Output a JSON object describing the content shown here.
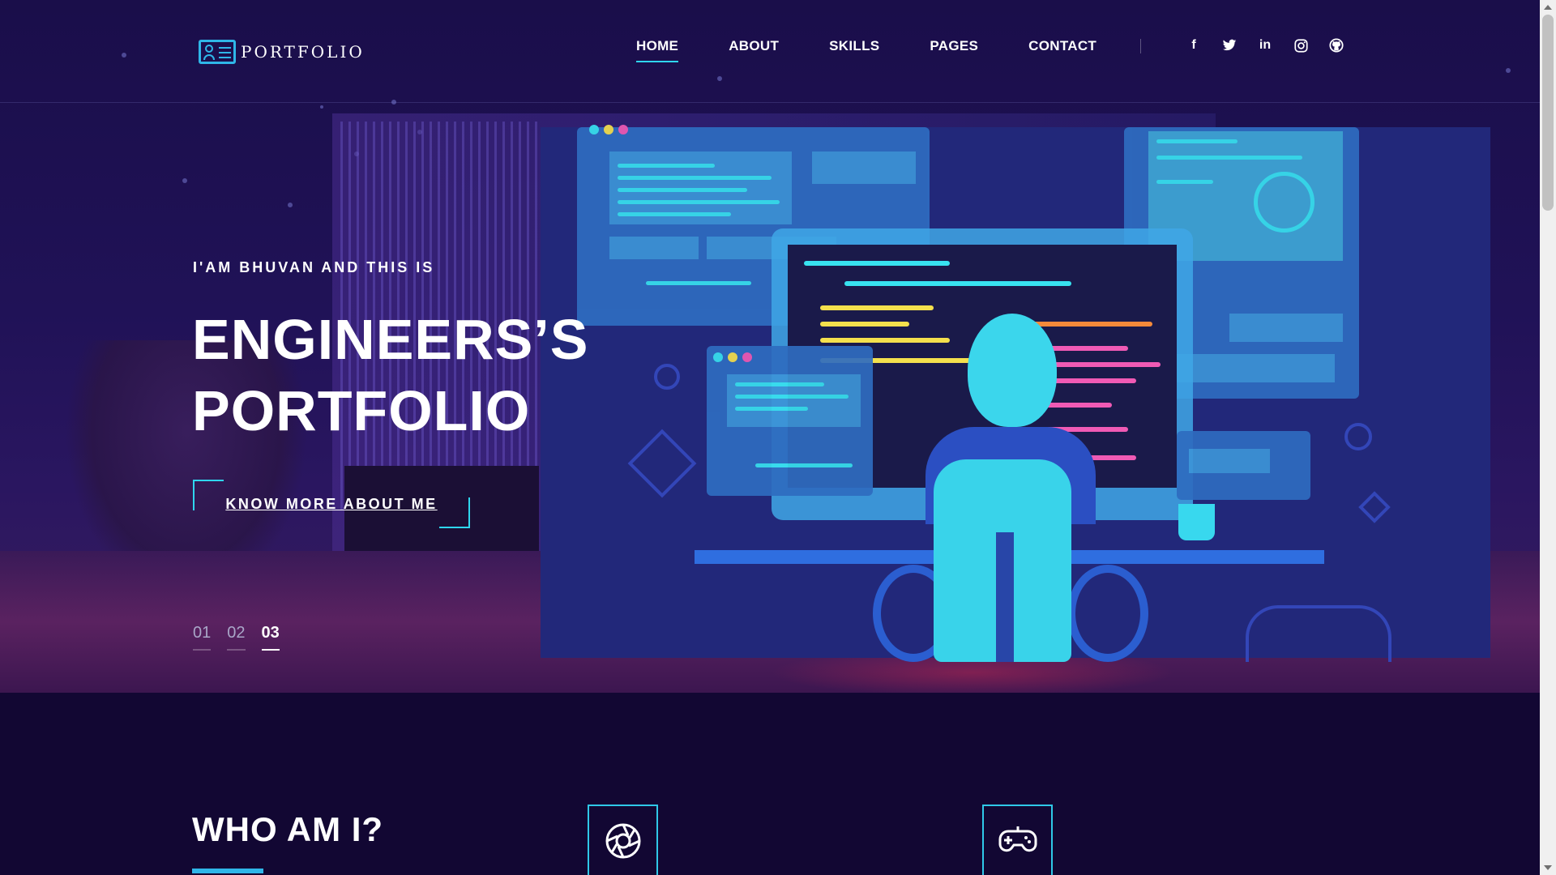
{
  "brand": {
    "logo_text": "PORTFOLIO"
  },
  "nav": {
    "items": [
      {
        "label": "HOME",
        "active": true
      },
      {
        "label": "ABOUT",
        "active": false
      },
      {
        "label": "SKILLS",
        "active": false
      },
      {
        "label": "PAGES",
        "active": false
      },
      {
        "label": "CONTACT",
        "active": false
      }
    ],
    "social": [
      {
        "icon": "facebook-icon",
        "glyph": "f"
      },
      {
        "icon": "twitter-icon",
        "glyph": "🐦"
      },
      {
        "icon": "linkedin-icon",
        "glyph": "in"
      },
      {
        "icon": "instagram-icon",
        "glyph": "◎"
      },
      {
        "icon": "github-icon",
        "glyph": "●"
      }
    ]
  },
  "hero": {
    "kicker": "I'AM BHUVAN AND THIS IS",
    "title_line1": "ENGINEERS’S",
    "title_line2": "PORTFOLIO",
    "cta_label": "KNOW MORE ABOUT ME",
    "slides": [
      "01",
      "02",
      "03"
    ],
    "active_slide": "03"
  },
  "about": {
    "title": "WHO AM I?",
    "icons": [
      "aperture-icon",
      "gamepad-icon"
    ]
  },
  "colors": {
    "accent": "#2fd6ee",
    "background": "#120733",
    "hero_bg": "#201257"
  }
}
